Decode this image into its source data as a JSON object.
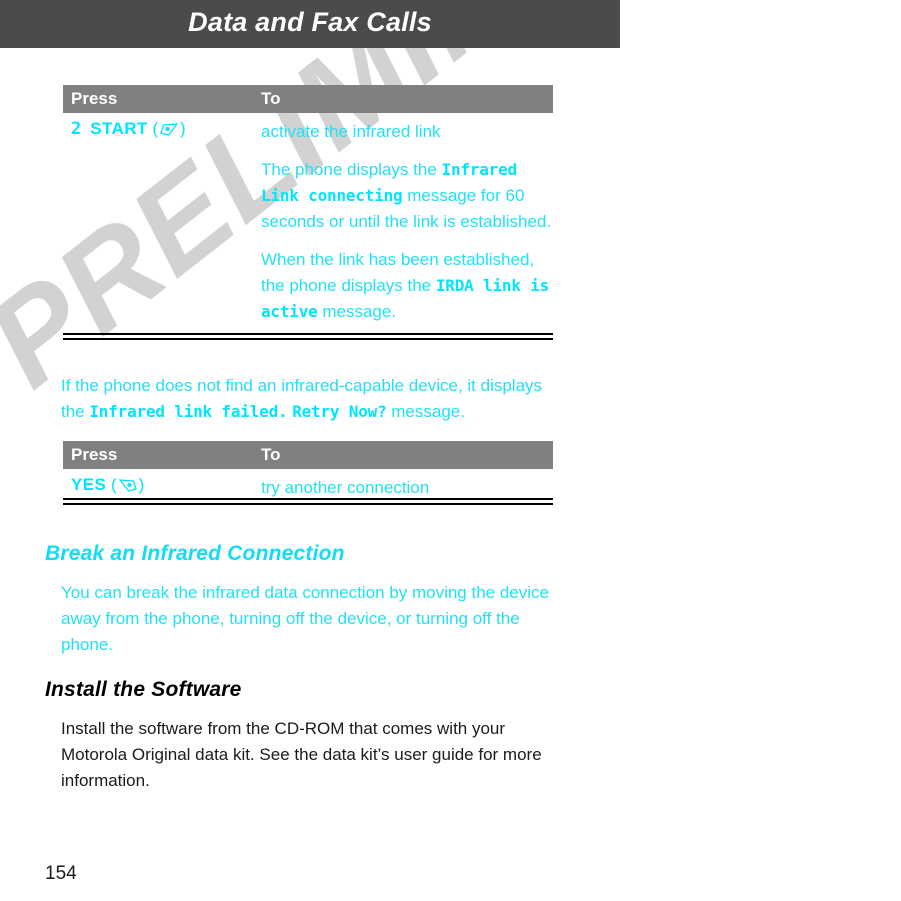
{
  "page": {
    "running_head": "Data and Fax Calls",
    "folio": "154",
    "watermark": "PRELIMINARY",
    "colors": {
      "header_bar": "#4b4b4b",
      "table_header_bar": "#808080",
      "cyan_text": "#22e1f5",
      "cyan_bold": "#00e5ff",
      "black_text": "#1a1a1a"
    }
  },
  "table1": {
    "headers": {
      "press": "Press",
      "to": "To"
    },
    "row": {
      "step_number": "2",
      "key_label": "START",
      "key_icon": "right-softkey-icon",
      "to_line1": "activate the infrared link",
      "to_para2_pre": "The phone displays the ",
      "to_para2_mono": "Infrared Link connecting",
      "to_para2_post": " message for 60 seconds or until the link is established.",
      "to_para3_pre": "When the link has been established, the phone displays the ",
      "to_para3_mono": "IRDA link is active",
      "to_para3_post": " message."
    }
  },
  "middle_paragraph": {
    "pre": "If the phone does not find an infrared-capable device, it displays the ",
    "mono1": "Infrared link failed.",
    "mid": " ",
    "mono2": "Retry Now?",
    "post": " message."
  },
  "table2": {
    "headers": {
      "press": "Press",
      "to": "To"
    },
    "row": {
      "key_label": "YES",
      "key_icon": "left-softkey-icon",
      "to": "try another connection"
    }
  },
  "section_break": {
    "heading": "Break an Infrared Connection",
    "body": "You can break the infrared data connection by moving the device away from the phone, turning off the device, or turning off the phone."
  },
  "section_install": {
    "heading": "Install the Software",
    "body": "Install the software from the CD-ROM that comes with your Motorola Original data kit. See the data kit’s user guide for more information."
  }
}
